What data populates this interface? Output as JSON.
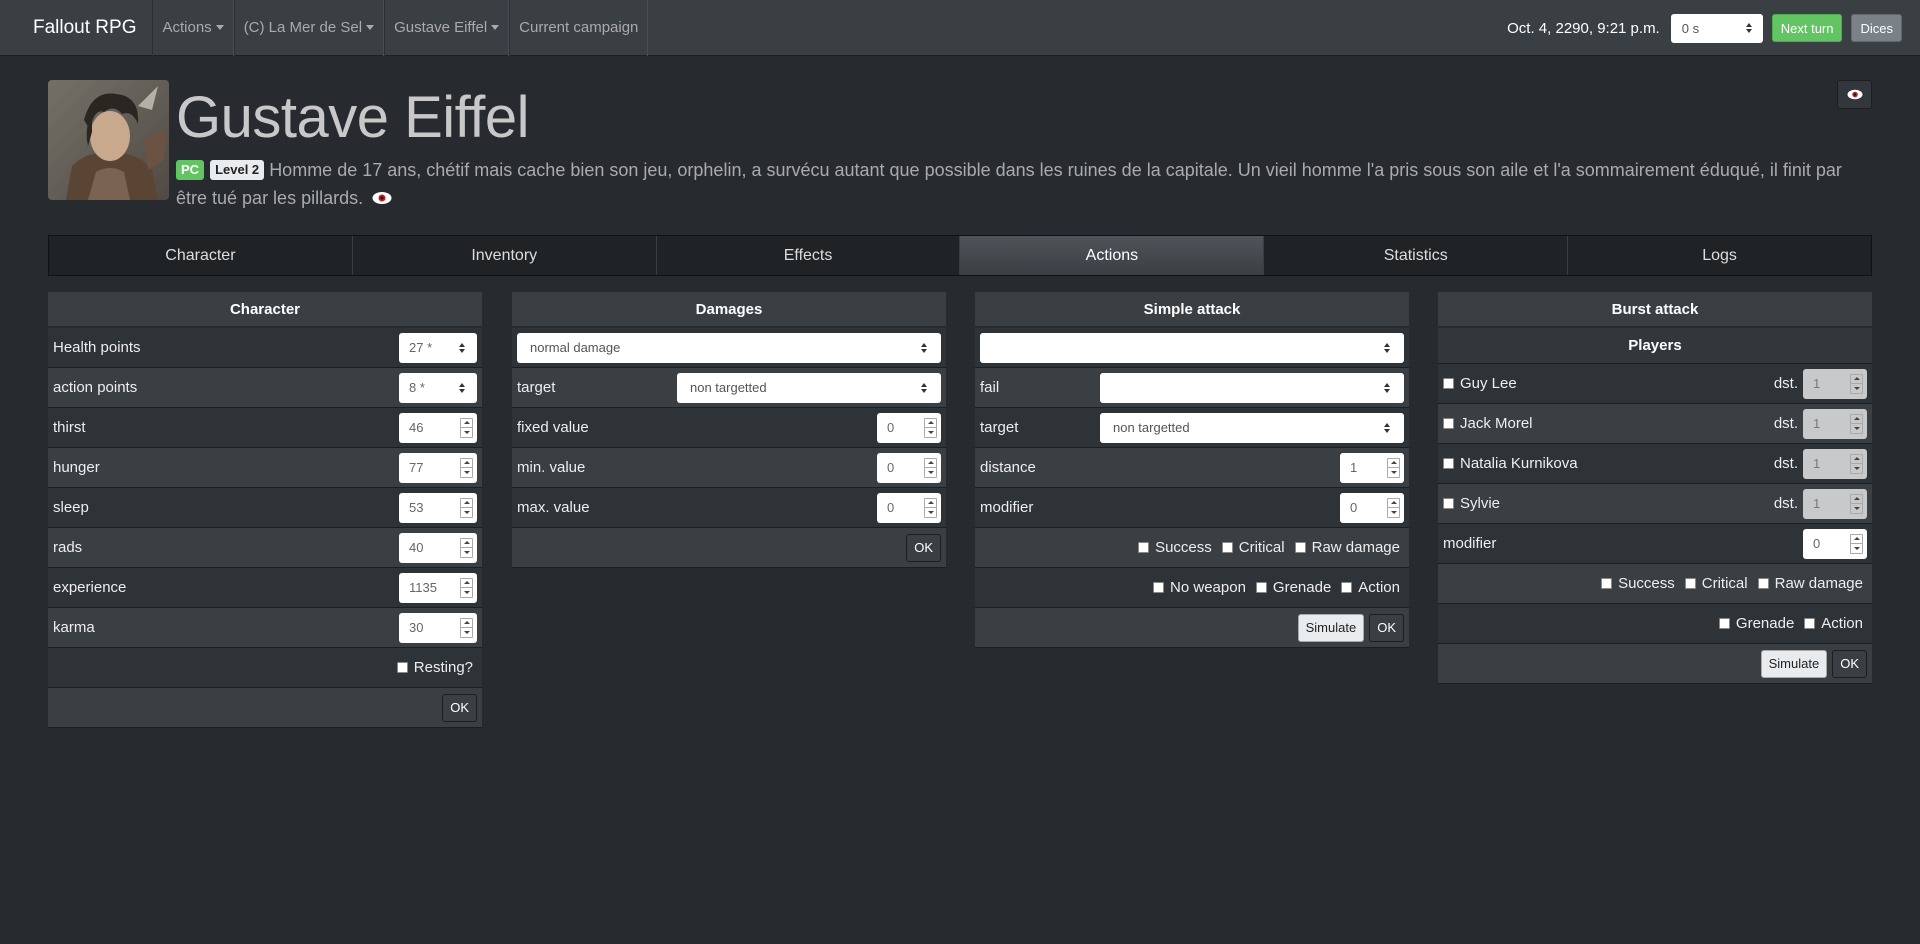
{
  "nav": {
    "brand": "Fallout RPG",
    "menus": [
      "Actions",
      "(C) La Mer de Sel",
      "Gustave Eiffel"
    ],
    "campaign_link": "Current campaign",
    "datetime": "Oct. 4, 2290, 9:21 p.m.",
    "duration_select": "0 s",
    "next_turn": "Next turn",
    "dices": "Dices"
  },
  "character": {
    "name": "Gustave Eiffel",
    "badge_type": "PC",
    "badge_level": "Level 2",
    "description": "Homme de 17 ans, chétif mais cache bien son jeu, orphelin, a survécu autant que possible dans les ruines de la capitale. Un vieil homme l'a pris sous son aile et l'a sommairement éduqué, il finit par être tué par les pillards."
  },
  "tabs": [
    "Character",
    "Inventory",
    "Effects",
    "Actions",
    "Statistics",
    "Logs"
  ],
  "active_tab": "Actions",
  "character_panel": {
    "title": "Character",
    "health_label": "Health points",
    "health_value": "27 *",
    "ap_label": "action points",
    "ap_value": "8 *",
    "stats": [
      {
        "label": "thirst",
        "value": "46"
      },
      {
        "label": "hunger",
        "value": "77"
      },
      {
        "label": "sleep",
        "value": "53"
      },
      {
        "label": "rads",
        "value": "40"
      },
      {
        "label": "experience",
        "value": "1135"
      },
      {
        "label": "karma",
        "value": "30"
      }
    ],
    "resting_label": "Resting?",
    "ok": "OK"
  },
  "damages_panel": {
    "title": "Damages",
    "damage_type": "normal damage",
    "target_label": "target",
    "target_value": "non targetted",
    "fields": [
      {
        "label": "fixed value",
        "value": "0"
      },
      {
        "label": "min. value",
        "value": "0"
      },
      {
        "label": "max. value",
        "value": "0"
      }
    ],
    "ok": "OK"
  },
  "simple_attack_panel": {
    "title": "Simple attack",
    "weapon_value": "",
    "fail_label": "fail",
    "fail_value": "",
    "target_label": "target",
    "target_value": "non targetted",
    "distance_label": "distance",
    "distance_value": "1",
    "modifier_label": "modifier",
    "modifier_value": "0",
    "checks_row1": [
      "Success",
      "Critical",
      "Raw damage"
    ],
    "checks_row2": [
      "No weapon",
      "Grenade",
      "Action"
    ],
    "simulate": "Simulate",
    "ok": "OK"
  },
  "burst_attack_panel": {
    "title": "Burst attack",
    "players_title": "Players",
    "dst_label": "dst.",
    "players": [
      {
        "name": "Guy Lee",
        "dst": "1"
      },
      {
        "name": "Jack Morel",
        "dst": "1"
      },
      {
        "name": "Natalia Kurnikova",
        "dst": "1"
      },
      {
        "name": "Sylvie",
        "dst": "1"
      }
    ],
    "modifier_label": "modifier",
    "modifier_value": "0",
    "checks_row1": [
      "Success",
      "Critical",
      "Raw damage"
    ],
    "checks_row2": [
      "Grenade",
      "Action"
    ],
    "simulate": "Simulate",
    "ok": "OK"
  },
  "colors": {
    "background": "#272b30",
    "navbar": "#3a3f44",
    "success": "#62c462",
    "secondary": "#7a8288"
  }
}
